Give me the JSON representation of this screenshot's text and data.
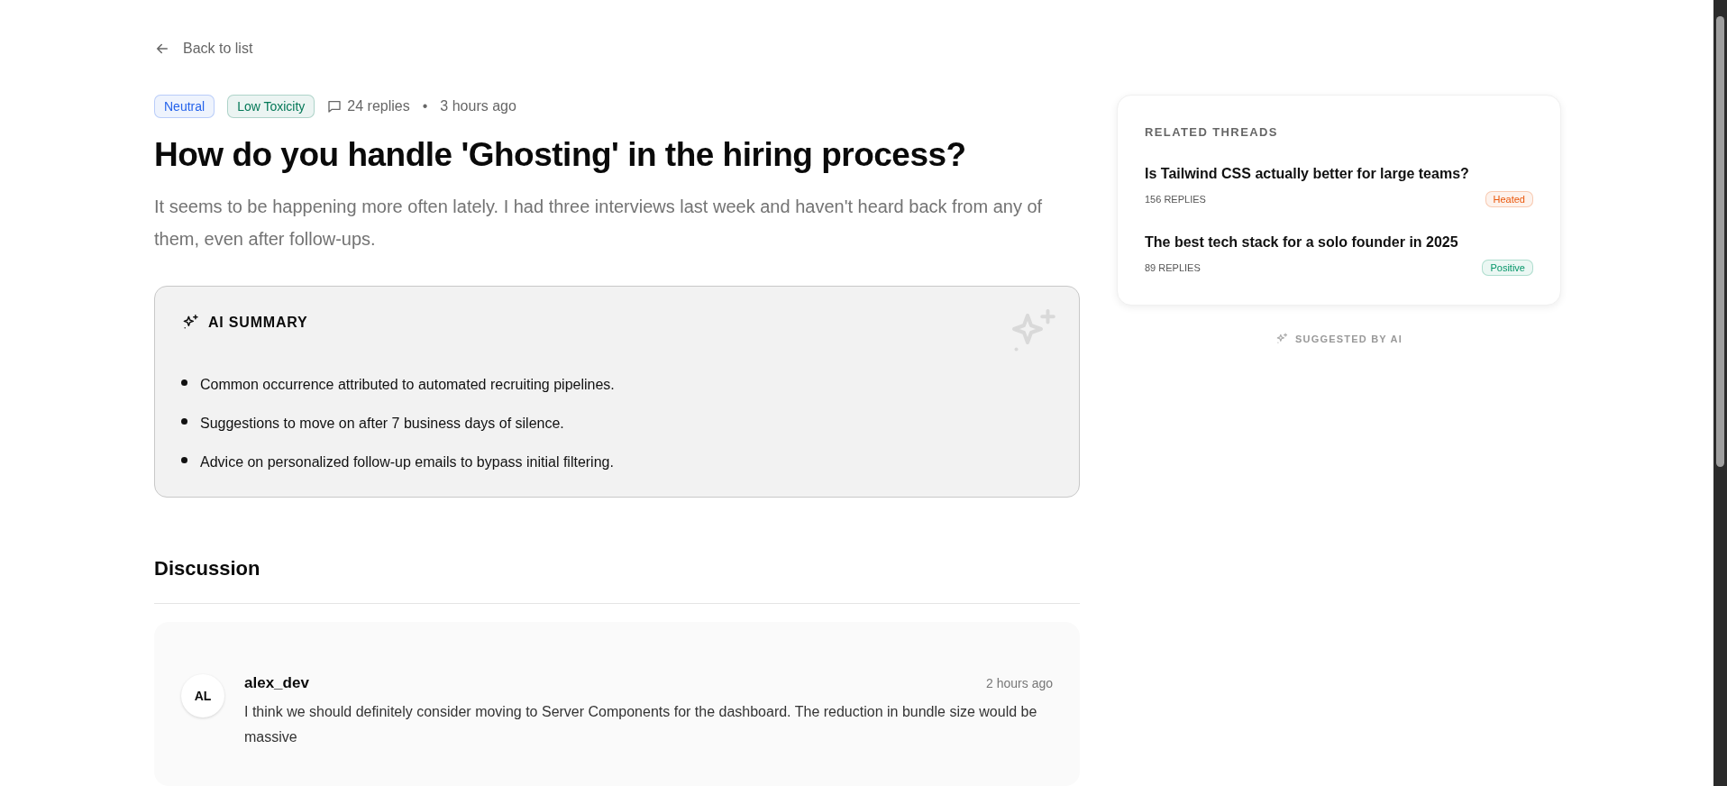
{
  "back_link": {
    "label": "Back to list"
  },
  "post": {
    "tags": [
      {
        "label": "Neutral",
        "color": "#2563eb"
      },
      {
        "label": "Low Toxicity",
        "color": "#047857"
      }
    ],
    "replies": "24 replies",
    "separator": "•",
    "time": "3 hours ago",
    "title": "How do you handle 'Ghosting' in the hiring process?",
    "body": "It seems to be happening more often lately. I had three interviews last week and haven't heard back from any of them, even after follow-ups."
  },
  "ai_summary": {
    "title": "AI SUMMARY",
    "points": [
      "Common occurrence attributed to automated recruiting pipelines.",
      "Suggestions to move on after 7 business days of silence.",
      "Advice on personalized follow-up emails to bypass initial filtering."
    ]
  },
  "discussion": {
    "title": "Discussion",
    "comments": [
      {
        "initials": "AL",
        "author": "alex_dev",
        "time": "2 hours ago",
        "text": "I think we should definitely consider moving to Server Components for the dashboard. The reduction in bundle size would be massive"
      }
    ]
  },
  "related_threads": {
    "title": "RELATED THREADS",
    "items": [
      {
        "title": "Is Tailwind CSS actually better for large teams?",
        "replies": "156 REPLIES",
        "tag": "Heated",
        "color": "#ea580c"
      },
      {
        "title": "The best tech stack for a solo founder in 2025",
        "replies": "89 REPLIES",
        "tag": "Positive",
        "color": "#059669"
      }
    ],
    "footer": "SUGGESTED BY AI"
  }
}
